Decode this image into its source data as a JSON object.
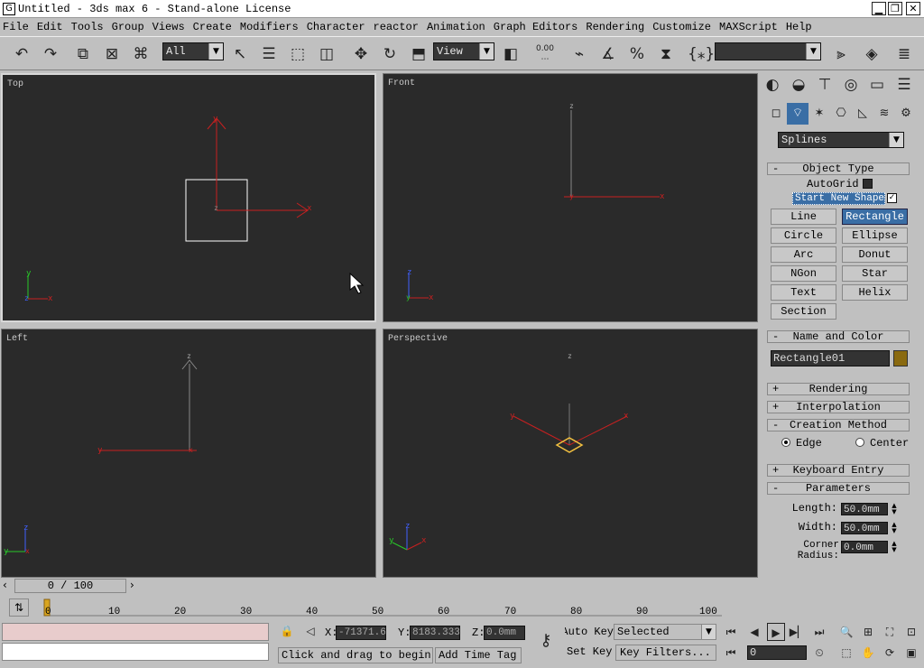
{
  "window": {
    "title": "Untitled - 3ds max 6 - Stand-alone License",
    "app_icon": "G",
    "minimize": "▁",
    "restore": "❐",
    "close": "✕"
  },
  "menu": [
    "File",
    "Edit",
    "Tools",
    "Group",
    "Views",
    "Create",
    "Modifiers",
    "Character",
    "reactor",
    "Animation",
    "Graph Editors",
    "Rendering",
    "Customize",
    "MAXScript",
    "Help"
  ],
  "toolbar": {
    "filter_select": "All",
    "ref_coord": "View",
    "snap_value": "0.00",
    "named_selection": ""
  },
  "viewports": {
    "top": "Top",
    "front": "Front",
    "left": "Left",
    "perspective": "Perspective"
  },
  "axes": {
    "x": "x",
    "y": "y",
    "z": "z"
  },
  "panel": {
    "category": "Splines",
    "object_type_title": "Object Type",
    "autogrid": "AutoGrid",
    "start_new_shape": "Start New Shape",
    "buttons": [
      "Line",
      "Rectangle",
      "Circle",
      "Ellipse",
      "Arc",
      "Donut",
      "NGon",
      "Star",
      "Text",
      "Helix",
      "Section"
    ],
    "active_button": "Rectangle",
    "name_color_title": "Name and Color",
    "object_name": "Rectangle01",
    "object_color": "#8a6a10",
    "rendering": "Rendering",
    "interpolation": "Interpolation",
    "creation_method": "Creation Method",
    "edge": "Edge",
    "center": "Center",
    "keyboard_entry": "Keyboard Entry",
    "parameters": "Parameters",
    "length_label": "Length:",
    "length": "50.0mm",
    "width_label": "Width:",
    "width": "50.0mm",
    "corner_label": "Corner Radius:",
    "corner": "0.0mm",
    "plus": "+",
    "minus": "-"
  },
  "timeline": {
    "slider": "0 / 100",
    "ticks": [
      "0",
      "10",
      "20",
      "30",
      "40",
      "50",
      "60",
      "70",
      "80",
      "90",
      "100"
    ]
  },
  "status": {
    "x_label": "X:",
    "x": "-71371.6",
    "y_label": "Y:",
    "y": "8183.333",
    "z_label": "Z:",
    "z": "0.0mm",
    "prompt": "Click and drag to begin",
    "add_time_tag": "Add Time Tag",
    "auto_key": "Auto Key",
    "selected": "Selected",
    "set_key": "Set Key",
    "key_filters": "Key Filters...",
    "frame": "0"
  }
}
